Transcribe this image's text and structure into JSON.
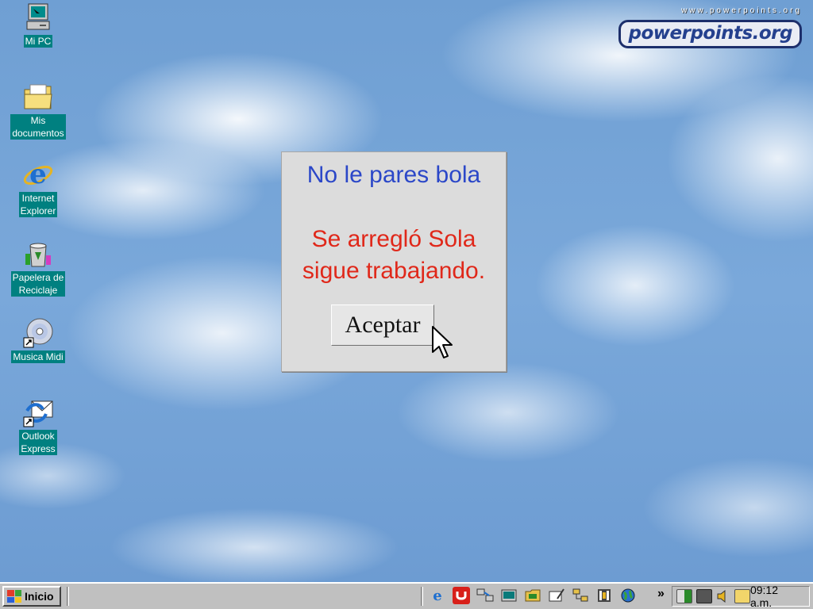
{
  "desktop": {
    "icons": [
      {
        "label": "Mi PC",
        "icon": "computer-icon"
      },
      {
        "label": "Mis\ndocumentos",
        "icon": "folder-icon"
      },
      {
        "label": "Internet\nExplorer",
        "icon": "internet-explorer-icon"
      },
      {
        "label": "Papelera de\nReciclaje",
        "icon": "recycle-bin-icon"
      },
      {
        "label": "Musica Midi",
        "icon": "cd-shortcut-icon"
      },
      {
        "label": "Outlook\nExpress",
        "icon": "outlook-express-icon"
      }
    ]
  },
  "branding": {
    "url": "www.powerpoints.org",
    "logo": "powerpoints.org"
  },
  "dialog": {
    "title": "No le pares bola",
    "body_line1": "Se arregló Sola",
    "body_line2": "sigue trabajando.",
    "button_label": "Aceptar"
  },
  "taskbar": {
    "start_label": "Inicio",
    "chevron": "»",
    "clock": "09:12 a.m."
  },
  "colors": {
    "dialog_title": "#2b47c8",
    "dialog_body": "#e0281a",
    "icon_label_bg": "#008080"
  }
}
